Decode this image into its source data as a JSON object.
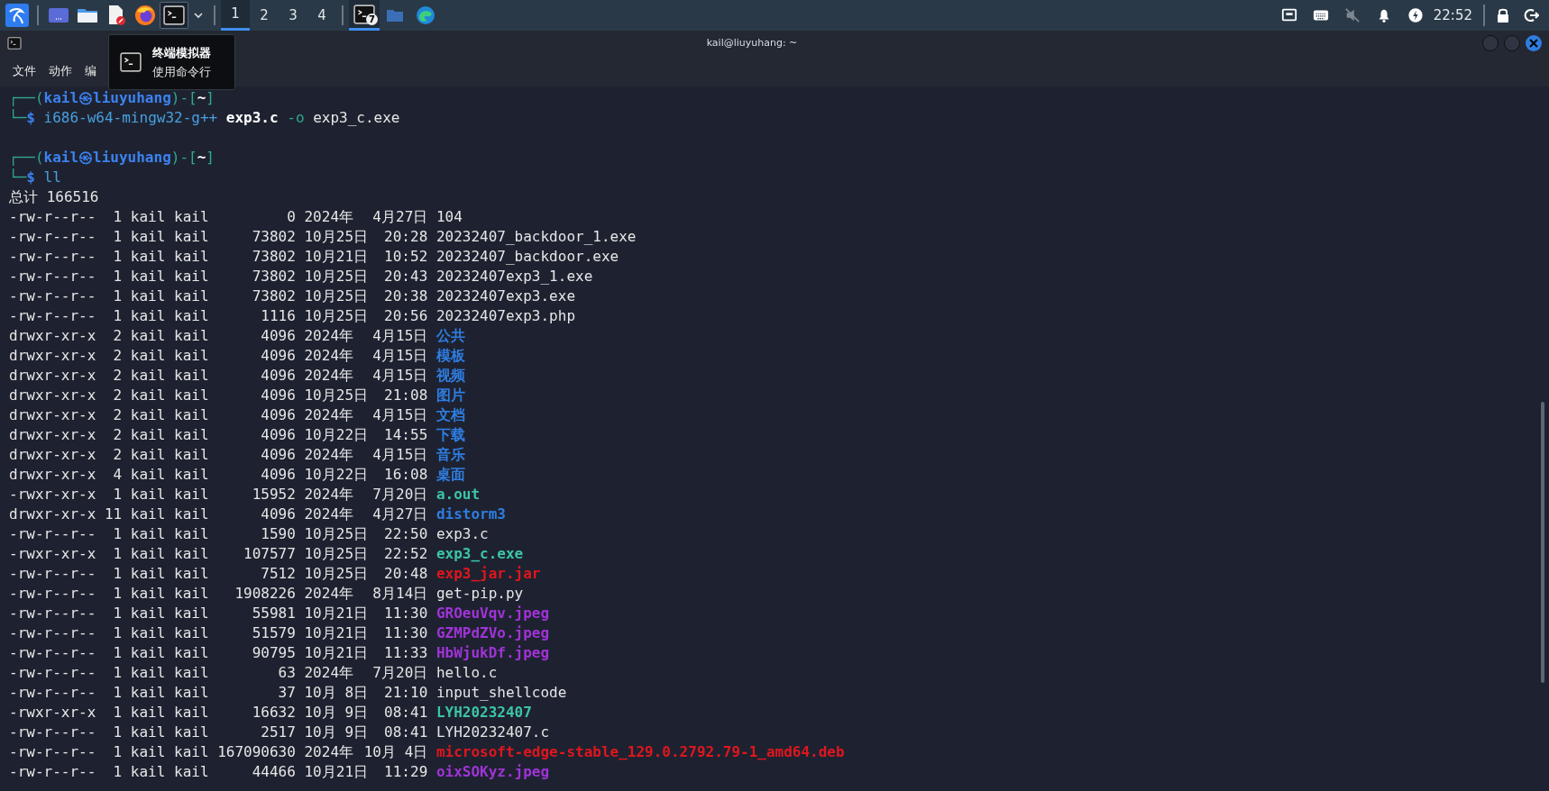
{
  "taskbar": {
    "launchers": [
      {
        "kind": "kali",
        "selected": false
      },
      {
        "kind": "desktop",
        "selected": false
      },
      {
        "kind": "files",
        "selected": false
      },
      {
        "kind": "editor",
        "selected": false
      },
      {
        "kind": "firefox",
        "selected": false
      },
      {
        "kind": "terminal",
        "selected": true
      }
    ],
    "workspaces": [
      {
        "label": "1",
        "selected": true
      },
      {
        "label": "2",
        "selected": false
      },
      {
        "label": "3",
        "selected": false
      },
      {
        "label": "4",
        "selected": false
      }
    ],
    "tasks": [
      {
        "kind": "terminal",
        "badge": "7",
        "selected": true
      },
      {
        "kind": "folder",
        "selected": false
      },
      {
        "kind": "edge",
        "selected": false
      }
    ],
    "tray": [
      {
        "kind": "network"
      },
      {
        "kind": "keyboard"
      },
      {
        "kind": "muted"
      },
      {
        "kind": "bell"
      },
      {
        "kind": "power"
      }
    ],
    "clock": "22:52"
  },
  "tooltip": {
    "title": "终端模拟器",
    "subtitle": "使用命令行"
  },
  "window": {
    "title": "kail@liuyuhang: ~",
    "menu": [
      "文件",
      "动作",
      "编"
    ]
  },
  "terminal": {
    "lines": [
      {
        "kind": "prompt",
        "segments": [
          {
            "text": "┌──(",
            "kind": "frame"
          },
          {
            "text": "kail㉿liuyuhang",
            "kind": "user"
          },
          {
            "text": ")-[",
            "kind": "frame"
          },
          {
            "text": "~",
            "kind": "dir"
          },
          {
            "text": "]",
            "kind": "frame"
          }
        ]
      },
      {
        "kind": "prompt",
        "segments": [
          {
            "text": "└─",
            "kind": "frame"
          },
          {
            "text": "$ ",
            "kind": "dollar"
          },
          {
            "text": "i686-w64-mingw32-g++",
            "kind": "command"
          },
          {
            "text": " exp3.c",
            "kind": "bold"
          },
          {
            "text": " -o",
            "kind": "option"
          },
          {
            "text": " exp3_c.exe",
            "kind": "plain"
          }
        ]
      },
      {
        "kind": "blank"
      },
      {
        "kind": "prompt",
        "segments": [
          {
            "text": "┌──(",
            "kind": "frame"
          },
          {
            "text": "kail㉿liuyuhang",
            "kind": "user"
          },
          {
            "text": ")-[",
            "kind": "frame"
          },
          {
            "text": "~",
            "kind": "dir"
          },
          {
            "text": "]",
            "kind": "frame"
          }
        ]
      },
      {
        "kind": "prompt",
        "segments": [
          {
            "text": "└─",
            "kind": "frame"
          },
          {
            "text": "$ ",
            "kind": "dollar"
          },
          {
            "text": "ll",
            "kind": "command"
          }
        ]
      },
      {
        "kind": "text",
        "text": "总计 166516"
      }
    ],
    "listing": [
      {
        "perms": "-rw-r--r--",
        "links": "1",
        "owner": "kail",
        "group": "kail",
        "size": "0",
        "date": "2024年",
        "time": "4月27日",
        "name": "104",
        "kind": "file"
      },
      {
        "perms": "-rw-r--r--",
        "links": "1",
        "owner": "kail",
        "group": "kail",
        "size": "73802",
        "date": "10月25日",
        "time": "20:28",
        "name": "20232407_backdoor_1.exe",
        "kind": "file"
      },
      {
        "perms": "-rw-r--r--",
        "links": "1",
        "owner": "kail",
        "group": "kail",
        "size": "73802",
        "date": "10月21日",
        "time": "10:52",
        "name": "20232407_backdoor.exe",
        "kind": "file"
      },
      {
        "perms": "-rw-r--r--",
        "links": "1",
        "owner": "kail",
        "group": "kail",
        "size": "73802",
        "date": "10月25日",
        "time": "20:43",
        "name": "20232407exp3_1.exe",
        "kind": "file"
      },
      {
        "perms": "-rw-r--r--",
        "links": "1",
        "owner": "kail",
        "group": "kail",
        "size": "73802",
        "date": "10月25日",
        "time": "20:38",
        "name": "20232407exp3.exe",
        "kind": "file"
      },
      {
        "perms": "-rw-r--r--",
        "links": "1",
        "owner": "kail",
        "group": "kail",
        "size": "1116",
        "date": "10月25日",
        "time": "20:56",
        "name": "20232407exp3.php",
        "kind": "file"
      },
      {
        "perms": "drwxr-xr-x",
        "links": "2",
        "owner": "kail",
        "group": "kail",
        "size": "4096",
        "date": "2024年",
        "time": "4月15日",
        "name": "公共",
        "kind": "dir"
      },
      {
        "perms": "drwxr-xr-x",
        "links": "2",
        "owner": "kail",
        "group": "kail",
        "size": "4096",
        "date": "2024年",
        "time": "4月15日",
        "name": "模板",
        "kind": "dir"
      },
      {
        "perms": "drwxr-xr-x",
        "links": "2",
        "owner": "kail",
        "group": "kail",
        "size": "4096",
        "date": "2024年",
        "time": "4月15日",
        "name": "视频",
        "kind": "dir"
      },
      {
        "perms": "drwxr-xr-x",
        "links": "2",
        "owner": "kail",
        "group": "kail",
        "size": "4096",
        "date": "10月25日",
        "time": "21:08",
        "name": "图片",
        "kind": "dir"
      },
      {
        "perms": "drwxr-xr-x",
        "links": "2",
        "owner": "kail",
        "group": "kail",
        "size": "4096",
        "date": "2024年",
        "time": "4月15日",
        "name": "文档",
        "kind": "dir"
      },
      {
        "perms": "drwxr-xr-x",
        "links": "2",
        "owner": "kail",
        "group": "kail",
        "size": "4096",
        "date": "10月22日",
        "time": "14:55",
        "name": "下载",
        "kind": "dir"
      },
      {
        "perms": "drwxr-xr-x",
        "links": "2",
        "owner": "kail",
        "group": "kail",
        "size": "4096",
        "date": "2024年",
        "time": "4月15日",
        "name": "音乐",
        "kind": "dir"
      },
      {
        "perms": "drwxr-xr-x",
        "links": "4",
        "owner": "kail",
        "group": "kail",
        "size": "4096",
        "date": "10月22日",
        "time": "16:08",
        "name": "桌面",
        "kind": "dir"
      },
      {
        "perms": "-rwxr-xr-x",
        "links": "1",
        "owner": "kail",
        "group": "kail",
        "size": "15952",
        "date": "2024年",
        "time": "7月20日",
        "name": "a.out",
        "kind": "exec"
      },
      {
        "perms": "drwxr-xr-x",
        "links": "11",
        "owner": "kail",
        "group": "kail",
        "size": "4096",
        "date": "2024年",
        "time": "4月27日",
        "name": "distorm3",
        "kind": "dir"
      },
      {
        "perms": "-rw-r--r--",
        "links": "1",
        "owner": "kail",
        "group": "kail",
        "size": "1590",
        "date": "10月25日",
        "time": "22:50",
        "name": "exp3.c",
        "kind": "file"
      },
      {
        "perms": "-rwxr-xr-x",
        "links": "1",
        "owner": "kail",
        "group": "kail",
        "size": "107577",
        "date": "10月25日",
        "time": "22:52",
        "name": "exp3_c.exe",
        "kind": "exec"
      },
      {
        "perms": "-rw-r--r--",
        "links": "1",
        "owner": "kail",
        "group": "kail",
        "size": "7512",
        "date": "10月25日",
        "time": "20:48",
        "name": "exp3_jar.jar",
        "kind": "archive"
      },
      {
        "perms": "-rw-r--r--",
        "links": "1",
        "owner": "kail",
        "group": "kail",
        "size": "1908226",
        "date": "2024年",
        "time": "8月14日",
        "name": "get-pip.py",
        "kind": "file"
      },
      {
        "perms": "-rw-r--r--",
        "links": "1",
        "owner": "kail",
        "group": "kail",
        "size": "55981",
        "date": "10月21日",
        "time": "11:30",
        "name": "GROeuVqv.jpeg",
        "kind": "image"
      },
      {
        "perms": "-rw-r--r--",
        "links": "1",
        "owner": "kail",
        "group": "kail",
        "size": "51579",
        "date": "10月21日",
        "time": "11:30",
        "name": "GZMPdZVo.jpeg",
        "kind": "image"
      },
      {
        "perms": "-rw-r--r--",
        "links": "1",
        "owner": "kail",
        "group": "kail",
        "size": "90795",
        "date": "10月21日",
        "time": "11:33",
        "name": "HbWjukDf.jpeg",
        "kind": "image"
      },
      {
        "perms": "-rw-r--r--",
        "links": "1",
        "owner": "kail",
        "group": "kail",
        "size": "63",
        "date": "2024年",
        "time": "7月20日",
        "name": "hello.c",
        "kind": "file"
      },
      {
        "perms": "-rw-r--r--",
        "links": "1",
        "owner": "kail",
        "group": "kail",
        "size": "37",
        "date": "10月 8日",
        "time": "21:10",
        "name": "input_shellcode",
        "kind": "file"
      },
      {
        "perms": "-rwxr-xr-x",
        "links": "1",
        "owner": "kail",
        "group": "kail",
        "size": "16632",
        "date": "10月 9日",
        "time": "08:41",
        "name": "LYH20232407",
        "kind": "exec"
      },
      {
        "perms": "-rw-r--r--",
        "links": "1",
        "owner": "kail",
        "group": "kail",
        "size": "2517",
        "date": "10月 9日",
        "time": "08:41",
        "name": "LYH20232407.c",
        "kind": "file"
      },
      {
        "perms": "-rw-r--r--",
        "links": "1",
        "owner": "kail",
        "group": "kail",
        "size": "167090630",
        "date": "2024年",
        "time": "10月 4日",
        "name": "microsoft-edge-stable_129.0.2792.79-1_amd64.deb",
        "kind": "archive"
      },
      {
        "perms": "-rw-r--r--",
        "links": "1",
        "owner": "kail",
        "group": "kail",
        "size": "44466",
        "date": "10月21日",
        "time": "11:29",
        "name": "oixSOKyz.jpeg",
        "kind": "image"
      }
    ]
  }
}
